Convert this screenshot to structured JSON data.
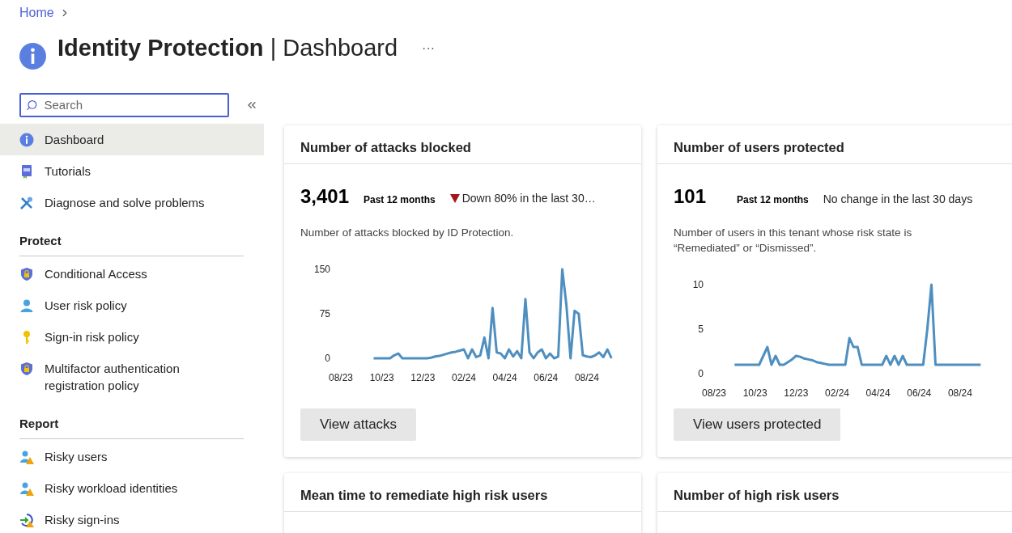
{
  "breadcrumb": {
    "items": [
      "Home"
    ]
  },
  "header": {
    "title": "**Identity Protection** | Dashboard",
    "more": "···"
  },
  "sidebar": {
    "search": {
      "placeholder": "Search"
    },
    "items": [
      {
        "label": "Dashboard",
        "selected": true
      },
      {
        "label": "Tutorials",
        "selected": false
      },
      {
        "label": "Diagnose and solve problems",
        "selected": false
      }
    ],
    "sections": [
      {
        "heading": "Protect",
        "items": [
          {
            "label": "Conditional Access",
            "selected": false
          },
          {
            "label": "User risk policy",
            "selected": false
          },
          {
            "label": "Sign-in risk policy",
            "selected": false
          },
          {
            "label": "Multifactor authentication registration policy",
            "selected": false
          }
        ]
      },
      {
        "heading": "Report",
        "items": [
          {
            "label": "Risky users",
            "selected": false
          },
          {
            "label": "Risky workload identities",
            "selected": false
          },
          {
            "label": "Risky sign-ins",
            "selected": false
          }
        ]
      }
    ]
  },
  "cards": [
    {
      "title": "Number of attacks blocked",
      "value": "3,401",
      "period": "Past 12 months",
      "trend": {
        "kind": "down",
        "text": "Down 80% in the last 30…"
      },
      "description": "Number of attacks blocked by ID Protection.",
      "button": "View attacks",
      "chart_data": {
        "type": "line",
        "ylim": [
          0,
          150
        ],
        "yticks": [
          0,
          75,
          150
        ],
        "categories": [
          "08/23",
          null,
          null,
          null,
          null,
          null,
          null,
          null,
          null,
          null,
          "10/23",
          null,
          null,
          null,
          null,
          null,
          null,
          null,
          null,
          null,
          "12/23",
          null,
          null,
          null,
          null,
          null,
          null,
          null,
          null,
          null,
          "02/24",
          null,
          null,
          null,
          null,
          null,
          null,
          null,
          null,
          null,
          "04/24",
          null,
          null,
          null,
          null,
          null,
          null,
          null,
          null,
          null,
          "06/24",
          null,
          null,
          null,
          null,
          null,
          null,
          null,
          null,
          null,
          "08/24",
          null,
          null,
          null,
          null,
          null,
          null,
          null
        ],
        "series": [
          {
            "color": "#4f8fc0",
            "values": [
              null,
              null,
              null,
              null,
              null,
              null,
              null,
              null,
              0,
              0,
              0,
              0,
              0,
              5,
              8,
              0,
              0,
              0,
              0,
              0,
              0,
              0,
              1,
              3,
              4,
              6,
              8,
              10,
              11,
              13,
              15,
              0,
              15,
              2,
              5,
              35,
              0,
              85,
              10,
              8,
              0,
              15,
              3,
              12,
              0,
              100,
              10,
              0,
              10,
              15,
              0,
              8,
              0,
              3,
              150,
              90,
              0,
              80,
              75,
              5,
              3,
              2,
              5,
              10,
              2,
              15,
              0,
              null
            ]
          }
        ]
      }
    },
    {
      "title": "Number of users protected",
      "value": "101",
      "period": "Past 12 months",
      "trend": {
        "kind": "none",
        "text": "No change in the last 30 days"
      },
      "description": "Number of users in this tenant whose risk state is “Remediated” or “Dismissed”.",
      "button": "View users protected",
      "chart_data": {
        "type": "line",
        "ylim": [
          0,
          10
        ],
        "yticks": [
          0,
          5,
          10
        ],
        "categories": [
          "08/23",
          null,
          null,
          null,
          null,
          null,
          null,
          null,
          null,
          null,
          "10/23",
          null,
          null,
          null,
          null,
          null,
          null,
          null,
          null,
          null,
          "12/23",
          null,
          null,
          null,
          null,
          null,
          null,
          null,
          null,
          null,
          "02/24",
          null,
          null,
          null,
          null,
          null,
          null,
          null,
          null,
          null,
          "04/24",
          null,
          null,
          null,
          null,
          null,
          null,
          null,
          null,
          null,
          "06/24",
          null,
          null,
          null,
          null,
          null,
          null,
          null,
          null,
          null,
          "08/24",
          null,
          null,
          null,
          null,
          null,
          null,
          null
        ],
        "series": [
          {
            "color": "#4f8fc0",
            "values": [
              null,
              null,
              null,
              null,
              null,
              1,
              1,
              1,
              1,
              1,
              1,
              1,
              2,
              3,
              1,
              2,
              1,
              1,
              1.3,
              1.6,
              2,
              1.9,
              1.7,
              1.6,
              1.5,
              1.3,
              1.2,
              1.1,
              1,
              1,
              1,
              1,
              1,
              4,
              3,
              3,
              1,
              1,
              1,
              1,
              1,
              1,
              2,
              1,
              2,
              1,
              2,
              1,
              1,
              1,
              1,
              1,
              5,
              10,
              1,
              1,
              1,
              1,
              1,
              1,
              1,
              1,
              1,
              1,
              1,
              1,
              null,
              null
            ]
          }
        ]
      }
    },
    {
      "title": "Mean time to remediate high risk users"
    },
    {
      "title": "Number of high risk users"
    }
  ]
}
